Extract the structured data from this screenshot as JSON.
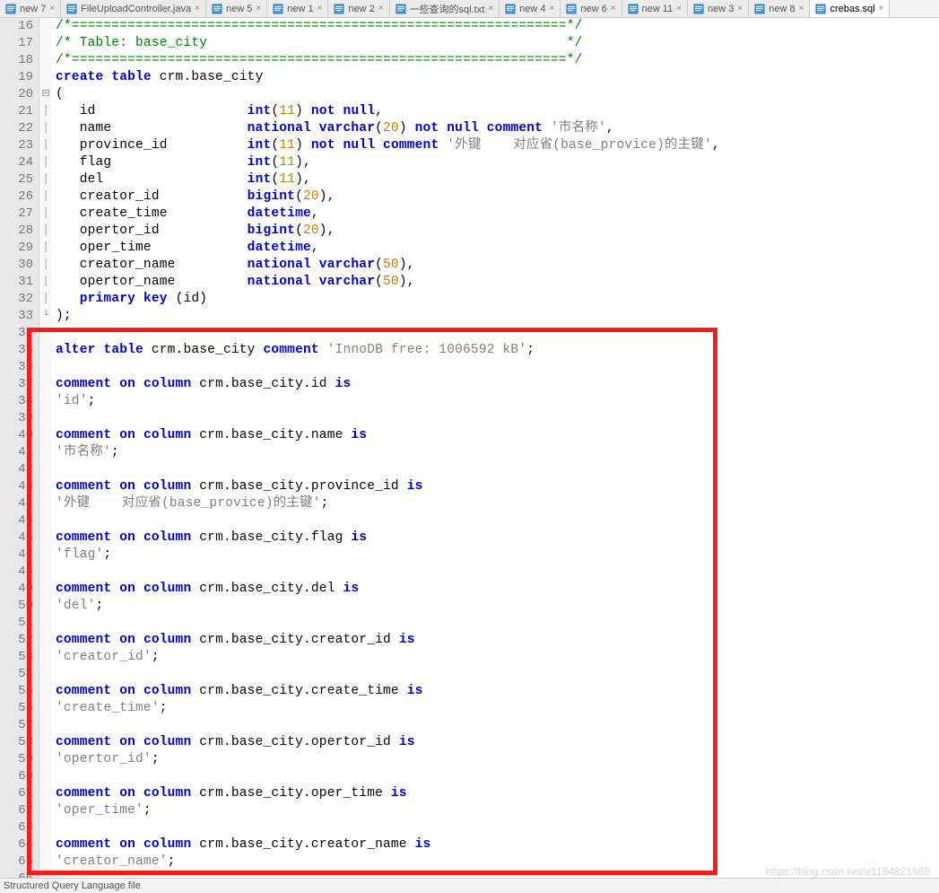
{
  "tabs": [
    {
      "label": "new 7",
      "active": false,
      "close": true
    },
    {
      "label": "FileUploadController.java",
      "active": false,
      "close": true
    },
    {
      "label": "new 5",
      "active": false,
      "close": true
    },
    {
      "label": "new 1",
      "active": false,
      "close": true
    },
    {
      "label": "new 2",
      "active": false,
      "close": true
    },
    {
      "label": "一些查询的sql.txt",
      "active": false,
      "close": true
    },
    {
      "label": "new 4",
      "active": false,
      "close": true
    },
    {
      "label": "new 6",
      "active": false,
      "close": true
    },
    {
      "label": "new 11",
      "active": false,
      "close": true
    },
    {
      "label": "new 3",
      "active": false,
      "close": true
    },
    {
      "label": "new 8",
      "active": false,
      "close": true
    },
    {
      "label": "crebas.sql",
      "active": true,
      "close": true
    }
  ],
  "line_start": 16,
  "line_end": 66,
  "code": {
    "divider": "/*==============================================================*/",
    "table_comment_open": "/* Table: base_city                                             */",
    "create_stmt": {
      "kw_create": "create",
      "kw_table": "table",
      "name": "crm.base_city"
    },
    "open_paren": "(",
    "columns": [
      {
        "name": "id",
        "pad": "                   ",
        "type": "int",
        "type_args": "11",
        "extra_kw": [
          "not",
          "null"
        ],
        "tail": ","
      },
      {
        "name": "name",
        "pad": "                 ",
        "type": "national varchar",
        "type_args": "20",
        "extra_kw": [
          "not",
          "null",
          "comment"
        ],
        "str": "'市名称'",
        "tail": ","
      },
      {
        "name": "province_id",
        "pad": "          ",
        "type": "int",
        "type_args": "11",
        "extra_kw": [
          "not",
          "null",
          "comment"
        ],
        "str": "'外键    对应省(base_provice)的主键'",
        "tail": ","
      },
      {
        "name": "flag",
        "pad": "                 ",
        "type": "int",
        "type_args": "11",
        "extra_kw": [],
        "tail": ","
      },
      {
        "name": "del",
        "pad": "                  ",
        "type": "int",
        "type_args": "11",
        "extra_kw": [],
        "tail": ","
      },
      {
        "name": "creator_id",
        "pad": "           ",
        "type": "bigint",
        "type_args": "20",
        "extra_kw": [],
        "tail": ","
      },
      {
        "name": "create_time",
        "pad": "          ",
        "type": "datetime",
        "type_args": null,
        "extra_kw": [],
        "tail": ","
      },
      {
        "name": "opertor_id",
        "pad": "           ",
        "type": "bigint",
        "type_args": "20",
        "extra_kw": [],
        "tail": ","
      },
      {
        "name": "oper_time",
        "pad": "            ",
        "type": "datetime",
        "type_args": null,
        "extra_kw": [],
        "tail": ","
      },
      {
        "name": "creator_name",
        "pad": "         ",
        "type": "national varchar",
        "type_args": "50",
        "extra_kw": [],
        "tail": ","
      },
      {
        "name": "opertor_name",
        "pad": "         ",
        "type": "national varchar",
        "type_args": "50",
        "extra_kw": [],
        "tail": ","
      }
    ],
    "pk": {
      "kw1": "primary",
      "kw2": "key",
      "col": "id"
    },
    "close_paren": ");",
    "alter": {
      "kw_alter": "alter",
      "kw_table": "table",
      "name": "crm.base_city",
      "kw_comment": "comment",
      "str": "'InnoDB free: 1006592 kB'"
    },
    "col_comments": [
      {
        "col": "crm.base_city.id",
        "val": "'id'"
      },
      {
        "col": "crm.base_city.name",
        "val": "'市名称'"
      },
      {
        "col": "crm.base_city.province_id",
        "val": "'外键    对应省(base_provice)的主键'"
      },
      {
        "col": "crm.base_city.flag",
        "val": "'flag'"
      },
      {
        "col": "crm.base_city.del",
        "val": "'del'"
      },
      {
        "col": "crm.base_city.creator_id",
        "val": "'creator_id'"
      },
      {
        "col": "crm.base_city.create_time",
        "val": "'create_time'"
      },
      {
        "col": "crm.base_city.opertor_id",
        "val": "'opertor_id'"
      },
      {
        "col": "crm.base_city.oper_time",
        "val": "'oper_time'"
      },
      {
        "col": "crm.base_city.creator_name",
        "val": "'creator_name'"
      }
    ],
    "kw_comment": "comment",
    "kw_on": "on",
    "kw_column": "column",
    "kw_is": "is"
  },
  "statusbar": "Structured Query Language file",
  "watermark": "https://blog.csdn.net/a1194821568"
}
